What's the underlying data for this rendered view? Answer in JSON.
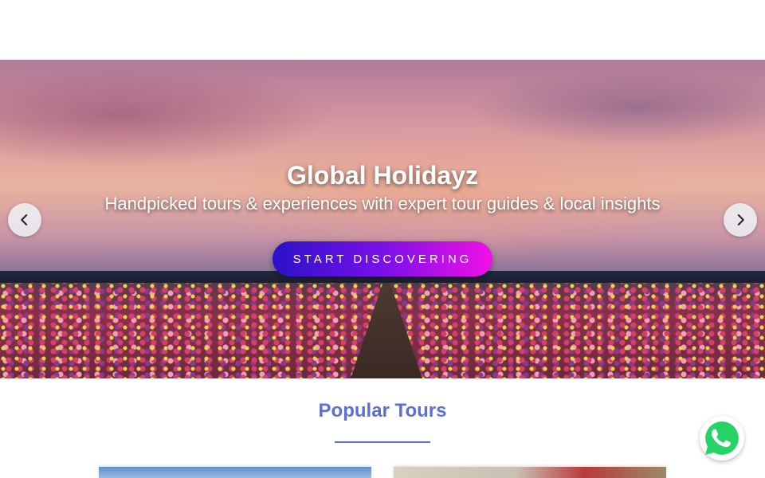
{
  "hero": {
    "title": "Global Holidayz",
    "subtitle": "Handpicked tours & experiences with expert tour guides & local insights",
    "cta_label": "START DISCOVERING",
    "prev_icon": "chevron-left-icon",
    "next_icon": "chevron-right-icon"
  },
  "popular_tours": {
    "title": "Popular Tours"
  },
  "floating": {
    "icon": "whatsapp-icon",
    "color": "#25D366"
  },
  "colors": {
    "accent": "#5b6fd6",
    "cta_start": "#2a12c8",
    "cta_end": "#f010e6"
  }
}
